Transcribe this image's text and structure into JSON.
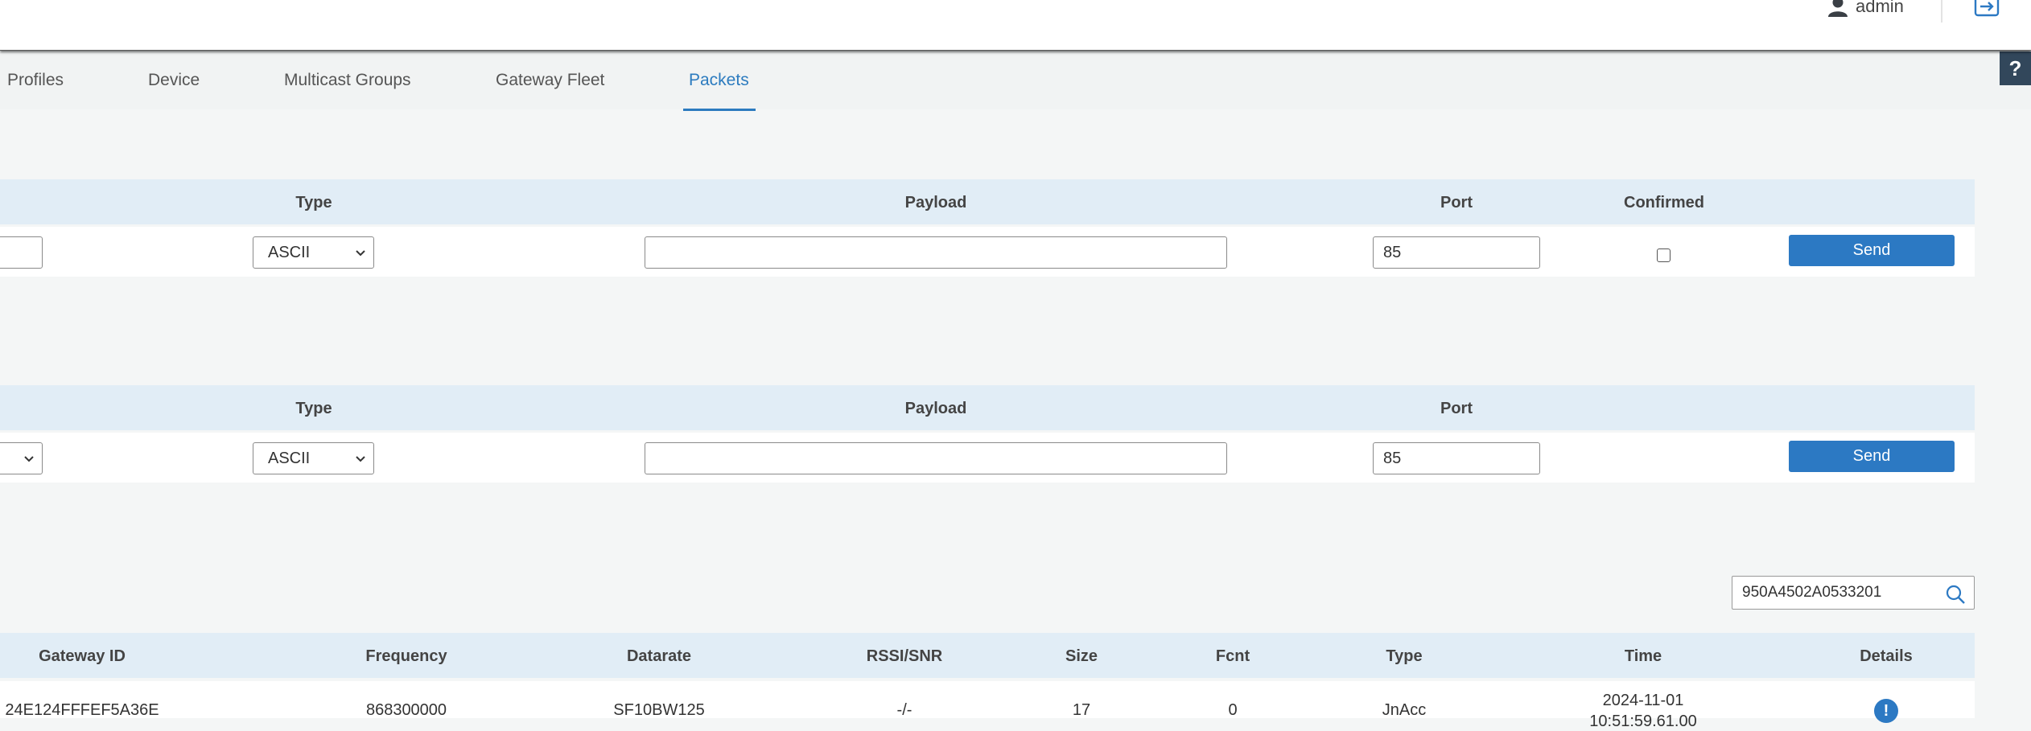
{
  "header": {
    "user": "admin"
  },
  "nav": {
    "tabs": [
      {
        "label": "Profiles"
      },
      {
        "label": "Device"
      },
      {
        "label": "Multicast Groups"
      },
      {
        "label": "Gateway Fleet"
      },
      {
        "label": "Packets",
        "active": true
      }
    ]
  },
  "help_label": "?",
  "form1": {
    "headers": {
      "type": "Type",
      "payload": "Payload",
      "port": "Port",
      "confirmed": "Confirmed"
    },
    "type_value": "ASCII",
    "payload_value": "",
    "port_value": "85",
    "confirmed": false,
    "send_label": "Send"
  },
  "form2": {
    "headers": {
      "type": "Type",
      "payload": "Payload",
      "port": "Port"
    },
    "type_value": "ASCII",
    "payload_value": "",
    "port_value": "85",
    "send_label": "Send"
  },
  "search": {
    "value": "950A4502A0533201"
  },
  "table": {
    "columns": [
      "Gateway ID",
      "Frequency",
      "Datarate",
      "RSSI/SNR",
      "Size",
      "Fcnt",
      "Type",
      "Time",
      "Details"
    ],
    "rows": [
      {
        "gateway_id": "24E124FFFEF5A36E",
        "frequency": "868300000",
        "datarate": "SF10BW125",
        "rssi_snr": "-/-",
        "size": "17",
        "fcnt": "0",
        "type": "JnAcc",
        "time_date": "2024-11-01",
        "time_clock": "10:51:59.61.00"
      }
    ]
  },
  "colors": {
    "accent": "#2c79c3",
    "header_bg": "#e1edf6",
    "help_bg": "#32475b"
  }
}
